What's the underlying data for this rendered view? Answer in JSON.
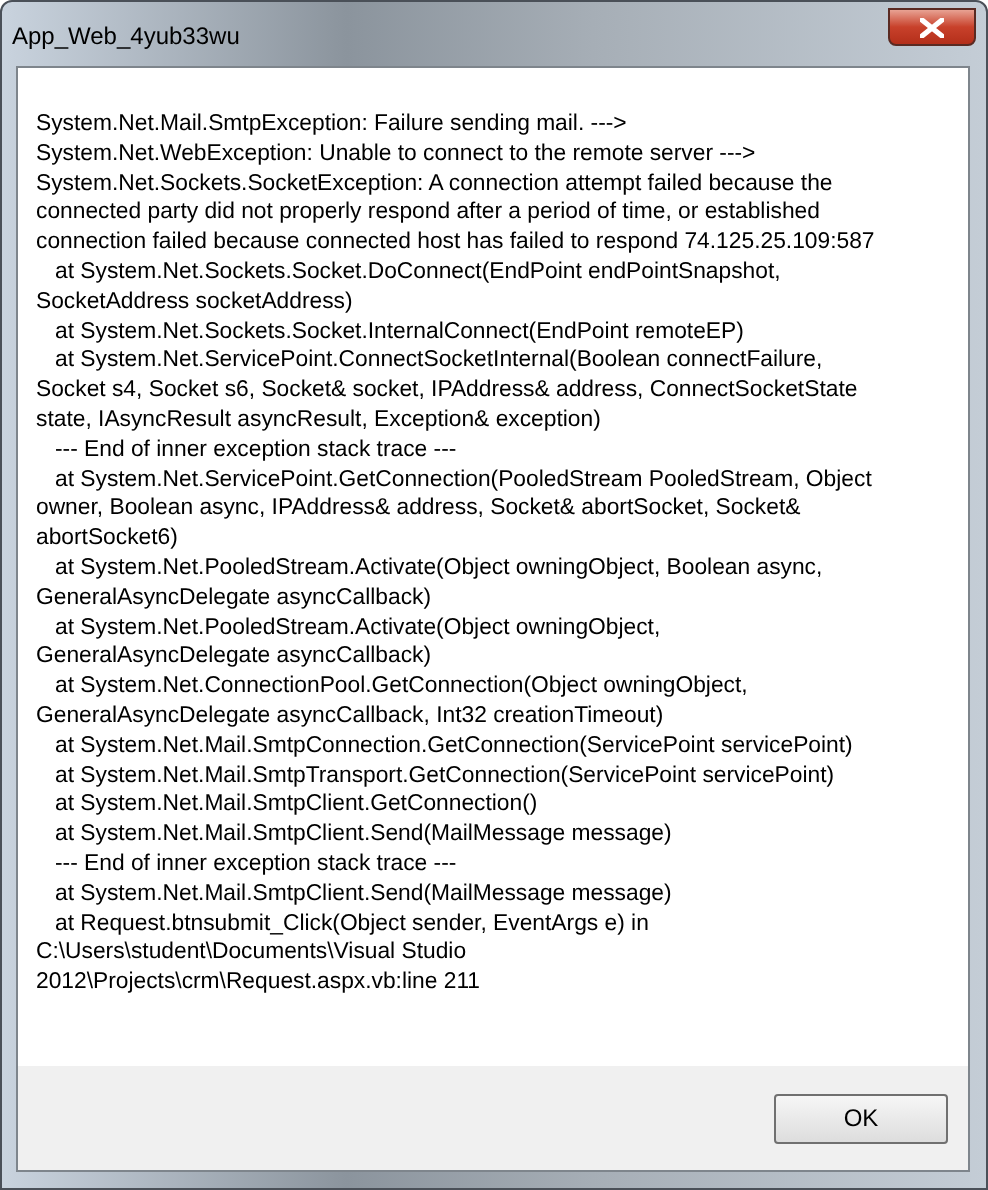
{
  "window": {
    "title": "App_Web_4yub33wu"
  },
  "message": "System.Net.Mail.SmtpException: Failure sending mail. --->\nSystem.Net.WebException: Unable to connect to the remote server --->\nSystem.Net.Sockets.SocketException: A connection attempt failed because the\nconnected party did not properly respond after a period of time, or established\nconnection failed because connected host has failed to respond 74.125.25.109:587\n   at System.Net.Sockets.Socket.DoConnect(EndPoint endPointSnapshot,\nSocketAddress socketAddress)\n   at System.Net.Sockets.Socket.InternalConnect(EndPoint remoteEP)\n   at System.Net.ServicePoint.ConnectSocketInternal(Boolean connectFailure,\nSocket s4, Socket s6, Socket& socket, IPAddress& address, ConnectSocketState\nstate, IAsyncResult asyncResult, Exception& exception)\n   --- End of inner exception stack trace ---\n   at System.Net.ServicePoint.GetConnection(PooledStream PooledStream, Object\nowner, Boolean async, IPAddress& address, Socket& abortSocket, Socket&\nabortSocket6)\n   at System.Net.PooledStream.Activate(Object owningObject, Boolean async,\nGeneralAsyncDelegate asyncCallback)\n   at System.Net.PooledStream.Activate(Object owningObject,\nGeneralAsyncDelegate asyncCallback)\n   at System.Net.ConnectionPool.GetConnection(Object owningObject,\nGeneralAsyncDelegate asyncCallback, Int32 creationTimeout)\n   at System.Net.Mail.SmtpConnection.GetConnection(ServicePoint servicePoint)\n   at System.Net.Mail.SmtpTransport.GetConnection(ServicePoint servicePoint)\n   at System.Net.Mail.SmtpClient.GetConnection()\n   at System.Net.Mail.SmtpClient.Send(MailMessage message)\n   --- End of inner exception stack trace ---\n   at System.Net.Mail.SmtpClient.Send(MailMessage message)\n   at Request.btnsubmit_Click(Object sender, EventArgs e) in\nC:\\Users\\student\\Documents\\Visual Studio\n2012\\Projects\\crm\\Request.aspx.vb:line 211",
  "buttons": [
    "OK"
  ]
}
